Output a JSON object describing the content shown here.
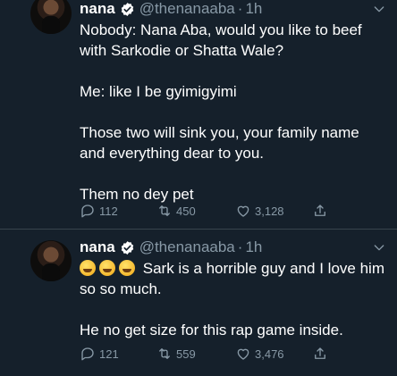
{
  "tweets": [
    {
      "name": "nana",
      "handle": "@thenanaaba",
      "dot": "·",
      "time": "1h",
      "paragraphs": [
        "Nobody: Nana Aba, would you like to beef with Sarkodie or Shatta Wale?",
        "Me: like I be gyimigyimi",
        "Those two will sink you, your family name and everything dear to you.",
        "Them no dey pet"
      ],
      "replies": "112",
      "retweets": "450",
      "likes": "3,128"
    },
    {
      "name": "nana",
      "handle": "@thenanaaba",
      "dot": "·",
      "time": "1h",
      "emoji_count": 3,
      "emoji_icon": "rolling-on-floor-laughing-emoji",
      "line1": "Sark is a horrible guy and I love him so so much.",
      "line2": "He no get size for this rap game inside.",
      "replies": "121",
      "retweets": "559",
      "likes": "3,476"
    }
  ],
  "colors": {
    "background": "#15202b",
    "text": "#ffffff",
    "muted": "#8899a6",
    "verified": "#1da1f2",
    "divider": "#38444d"
  }
}
